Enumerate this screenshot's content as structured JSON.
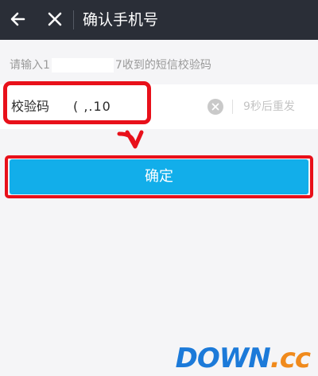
{
  "header": {
    "title": "确认手机号",
    "back_icon": "back-arrow-icon",
    "close_icon": "close-icon"
  },
  "hint": {
    "prefix": "请输入1",
    "suffix": "7收到的短信校验码"
  },
  "code_field": {
    "label": "校验码",
    "value": "( ,.10",
    "clear_icon": "clear-circle-icon",
    "resend_label": "9秒后重发"
  },
  "confirm_button": {
    "label": "确定",
    "color": "#12aeea"
  },
  "annotation": {
    "highlight_color": "#e8101a"
  },
  "watermark": {
    "main": "DOWN",
    "dot": ".",
    "suffix": "cc"
  }
}
